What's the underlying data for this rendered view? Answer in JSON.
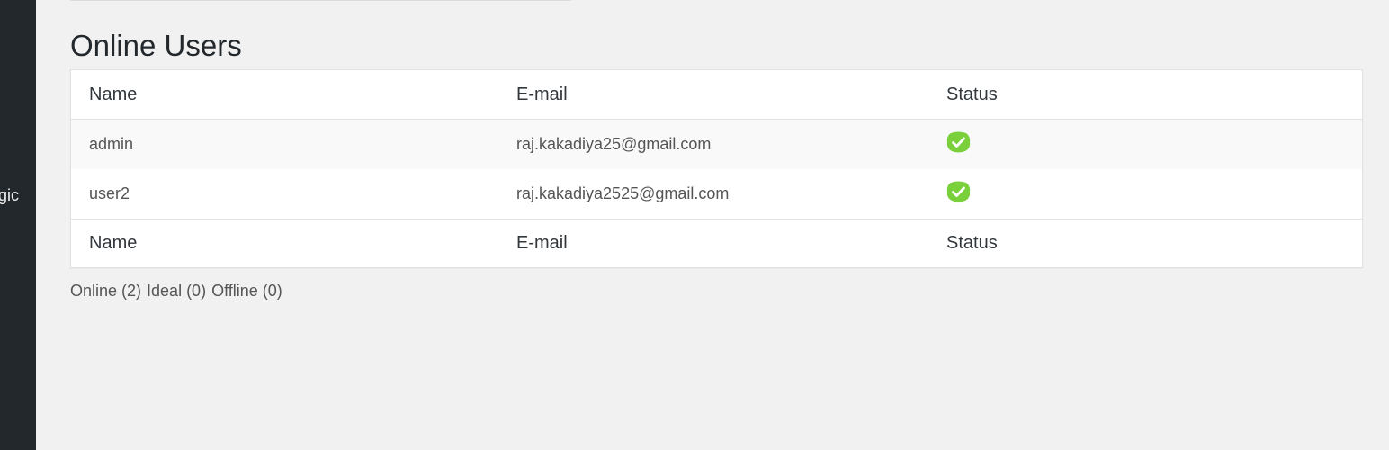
{
  "sidebar": {
    "partial_item_label": "gic"
  },
  "page": {
    "title": "Online Users"
  },
  "table": {
    "columns": [
      "Name",
      "E-mail",
      "Status"
    ],
    "rows": [
      {
        "name": "admin",
        "email": "raj.kakadiya25@gmail.com",
        "status": "online",
        "status_icon": "check-badge-icon"
      },
      {
        "name": "user2",
        "email": "raj.kakadiya2525@gmail.com",
        "status": "online",
        "status_icon": "check-badge-icon"
      }
    ],
    "footer_columns": [
      "Name",
      "E-mail",
      "Status"
    ]
  },
  "summary": {
    "online": "Online (2)",
    "ideal": "Ideal (0)",
    "offline": "Offline (0)"
  },
  "colors": {
    "sidebar_bg": "#23282d",
    "page_bg": "#f1f1f1",
    "status_online": "#7ad03a"
  }
}
